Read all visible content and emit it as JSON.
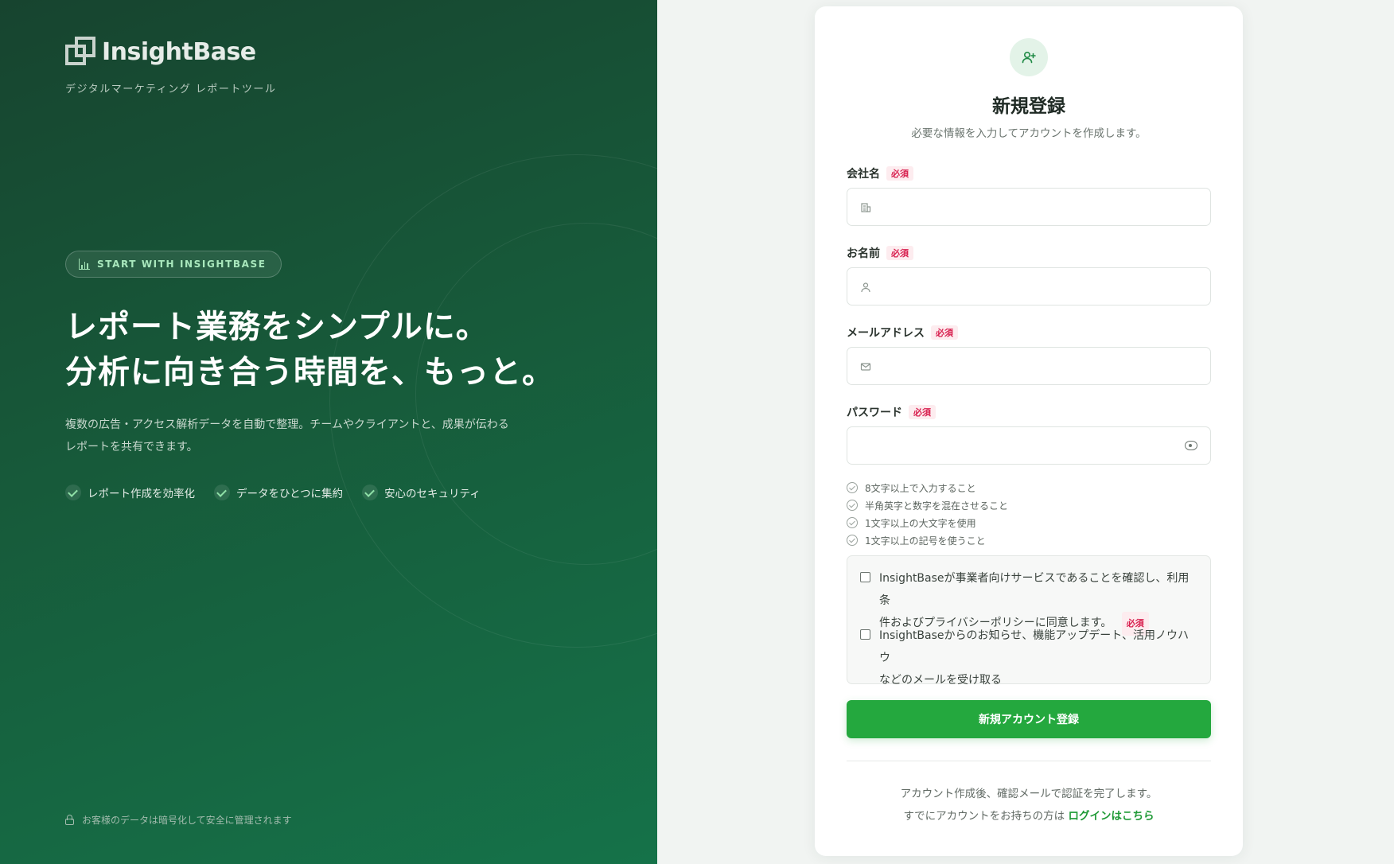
{
  "brand": {
    "name": "InsightBase",
    "tagline": "デジタルマーケティング レポートツール"
  },
  "hero": {
    "pill_label": "START WITH INSIGHTBASE",
    "headline_line1": "レポート業務をシンプルに。",
    "headline_line2": "分析に向き合う時間を、もっと。",
    "description_line1": "複数の広告・アクセス解析データを自動で整理。チームやクライアントと、成果が伝わる",
    "description_line2": "レポートを共有できます。",
    "features": [
      "レポート作成を効率化",
      "データをひとつに集約",
      "安心のセキュリティ"
    ],
    "security_note": "お客様のデータは暗号化して安全に管理されます"
  },
  "form": {
    "title": "新規登録",
    "subtitle": "必要な情報を入力してアカウントを作成します。",
    "required_badge": "必須",
    "fields": {
      "company": {
        "label": "会社名",
        "value": "",
        "placeholder": ""
      },
      "name": {
        "label": "お名前",
        "value": "",
        "placeholder": ""
      },
      "email": {
        "label": "メールアドレス",
        "value": "",
        "placeholder": ""
      },
      "password": {
        "label": "パスワード",
        "value": "",
        "placeholder": ""
      }
    },
    "password_rules": [
      "8文字以上で入力すること",
      "半角英字と数字を混在させること",
      "1文字以上の大文字を使用",
      "1文字以上の記号を使うこと"
    ],
    "terms_line1": "InsightBaseが事業者向けサービスであることを確認し、利用条",
    "terms_line2": "件およびプライバシーポリシーに同意します。",
    "newsletter_line1": "InsightBaseからのお知らせ、機能アップデート、活用ノウハウ",
    "newsletter_line2": "などのメールを受け取る",
    "submit_label": "新規アカウント登録",
    "footer_note": "アカウント作成後、確認メールで認証を完了します。",
    "login_prompt": "すでにアカウントをお持ちの方は",
    "login_link": "ログインはこちら"
  },
  "icons": {
    "logo": "logo-icon",
    "pill": "bar-chart-icon",
    "feature": "check-icon",
    "lock": "lock-icon",
    "avatar": "user-plus-icon",
    "company": "building-icon",
    "name": "user-icon",
    "email": "mail-icon",
    "password_toggle": "eye-icon",
    "rule": "check-circle-icon"
  },
  "colors": {
    "accent": "#24a83e",
    "required": "#d8204f",
    "hero_dark": "#17442f",
    "hero_light": "#157249"
  }
}
